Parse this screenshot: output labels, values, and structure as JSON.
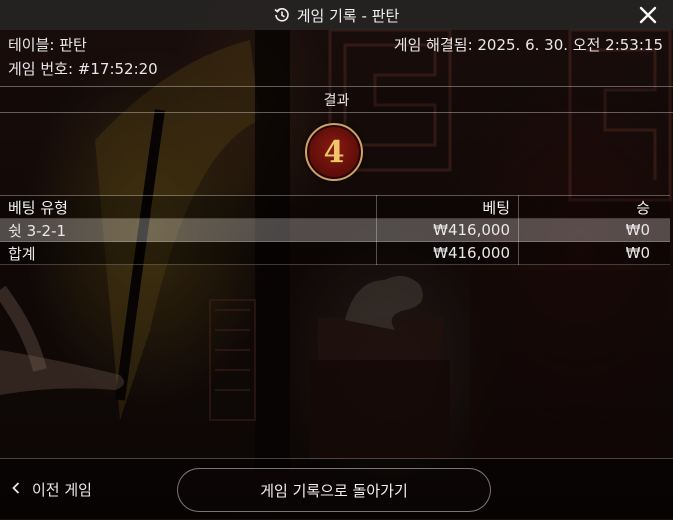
{
  "titlebar": {
    "title": "게임 기록 - 판탄",
    "history_icon": "history-clock-icon",
    "close_icon": "close-icon"
  },
  "info": {
    "table_label": "테이블: 판탄",
    "resolved_label": "게임 해결됨: 2025. 6. 30. 오전 2:53:15",
    "game_number_label": "게임 번호: #17:52:20"
  },
  "result": {
    "header": "결과",
    "value": "4",
    "badge_colors": {
      "fill": "#6e110b",
      "ring": "#c9a468",
      "digit": "#f2c46c"
    }
  },
  "bets_table": {
    "columns": [
      "베팅 유형",
      "베팅",
      "승"
    ],
    "rows": [
      {
        "type": "쉿 3-2-1",
        "bet": "₩416,000",
        "win": "₩0"
      }
    ],
    "total": {
      "type": "합계",
      "bet": "₩416,000",
      "win": "₩0"
    }
  },
  "footer": {
    "prev_label": "이전 게임",
    "prev_icon": "chevron-left-icon",
    "back_label": "게임 기록으로 돌아가기"
  }
}
